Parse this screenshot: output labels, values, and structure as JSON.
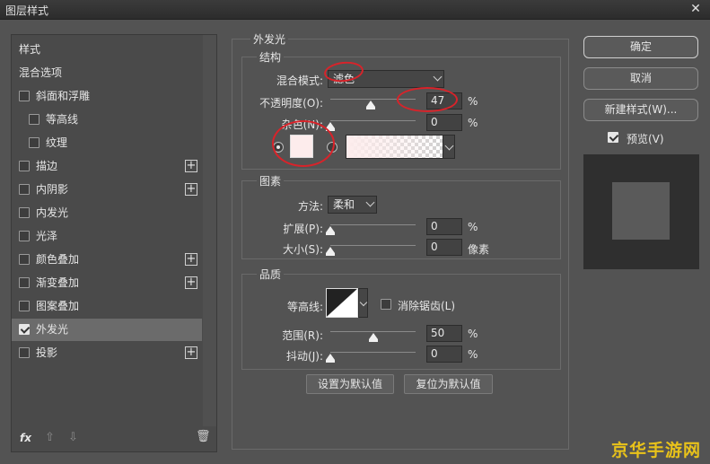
{
  "window": {
    "title": "图层样式",
    "close": "✕"
  },
  "left_panel": {
    "items": [
      {
        "label": "样式",
        "checkbox": false,
        "checked": false,
        "indent": 0,
        "plus": false
      },
      {
        "label": "混合选项",
        "checkbox": false,
        "checked": false,
        "indent": 0,
        "plus": false
      },
      {
        "label": "斜面和浮雕",
        "checkbox": true,
        "checked": false,
        "indent": 0,
        "plus": false
      },
      {
        "label": "等高线",
        "checkbox": true,
        "checked": false,
        "indent": 1,
        "plus": false
      },
      {
        "label": "纹理",
        "checkbox": true,
        "checked": false,
        "indent": 1,
        "plus": false
      },
      {
        "label": "描边",
        "checkbox": true,
        "checked": false,
        "indent": 0,
        "plus": true
      },
      {
        "label": "内阴影",
        "checkbox": true,
        "checked": false,
        "indent": 0,
        "plus": true
      },
      {
        "label": "内发光",
        "checkbox": true,
        "checked": false,
        "indent": 0,
        "plus": false
      },
      {
        "label": "光泽",
        "checkbox": true,
        "checked": false,
        "indent": 0,
        "plus": false
      },
      {
        "label": "颜色叠加",
        "checkbox": true,
        "checked": false,
        "indent": 0,
        "plus": true
      },
      {
        "label": "渐变叠加",
        "checkbox": true,
        "checked": false,
        "indent": 0,
        "plus": true
      },
      {
        "label": "图案叠加",
        "checkbox": true,
        "checked": false,
        "indent": 0,
        "plus": false
      },
      {
        "label": "外发光",
        "checkbox": true,
        "checked": true,
        "indent": 0,
        "plus": false,
        "selected": true
      },
      {
        "label": "投影",
        "checkbox": true,
        "checked": false,
        "indent": 0,
        "plus": true
      }
    ],
    "footer": {
      "fx": "fx",
      "up": "⇧",
      "down": "⇩",
      "trash": "🗑"
    }
  },
  "outer_glow": {
    "title": "外发光",
    "structure": {
      "title": "结构",
      "blend_mode_label": "混合模式:",
      "blend_mode_value": "滤色",
      "opacity_label": "不透明度(O):",
      "opacity_value": "47",
      "opacity_unit": "%",
      "opacity_fraction": 0.47,
      "noise_label": "杂色(N):",
      "noise_value": "0",
      "noise_unit": "%",
      "noise_fraction": 0,
      "glow_color": "#fdecec"
    },
    "elements": {
      "title": "图素",
      "technique_label": "方法:",
      "technique_value": "柔和",
      "spread_label": "扩展(P):",
      "spread_value": "0",
      "spread_unit": "%",
      "spread_fraction": 0,
      "size_label": "大小(S):",
      "size_value": "0",
      "size_unit": "像素",
      "size_fraction": 0
    },
    "quality": {
      "title": "品质",
      "contour_label": "等高线:",
      "antialias_label": "消除锯齿(L)",
      "antialias_checked": false,
      "range_label": "范围(R):",
      "range_value": "50",
      "range_unit": "%",
      "range_fraction": 0.5,
      "jitter_label": "抖动(J):",
      "jitter_value": "0",
      "jitter_unit": "%",
      "jitter_fraction": 0
    },
    "make_default_label": "设置为默认值",
    "reset_default_label": "复位为默认值"
  },
  "right_panel": {
    "ok_label": "确定",
    "cancel_label": "取消",
    "new_style_label": "新建样式(W)...",
    "preview_label": "预览(V)",
    "preview_checked": true
  },
  "watermark": "京华手游网",
  "colors": {
    "annotation_red": "#d8232a",
    "watermark": "#e8c21a"
  }
}
